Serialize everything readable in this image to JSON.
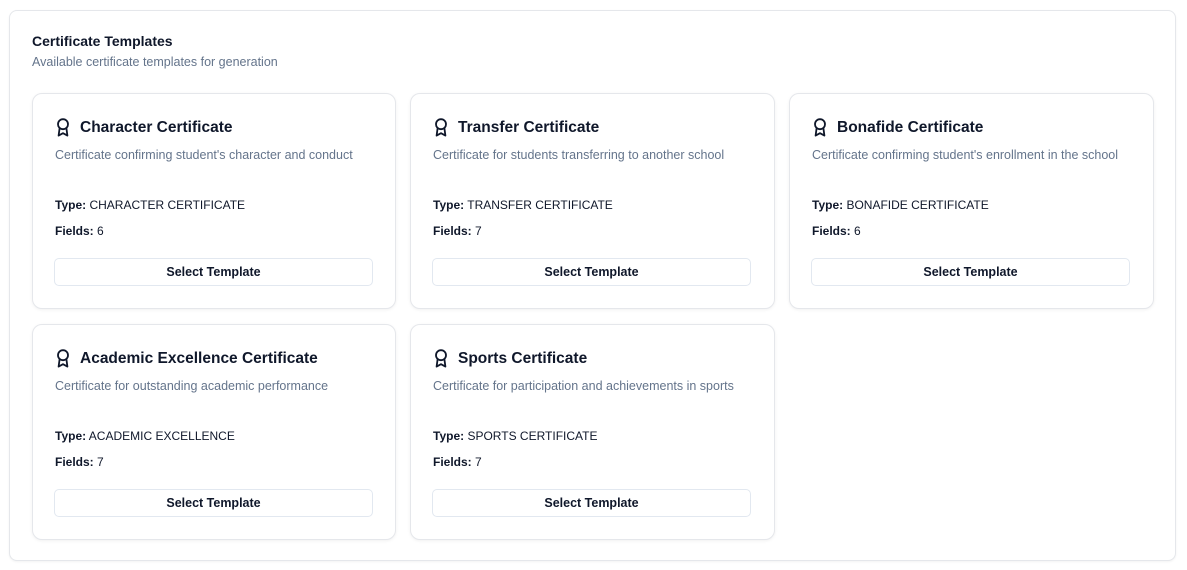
{
  "panel": {
    "title": "Certificate Templates",
    "subtitle": "Available certificate templates for generation"
  },
  "templates": [
    {
      "title": "Character Certificate",
      "description": "Certificate confirming student's character and conduct",
      "type_label": "Type:",
      "type_value": "CHARACTER CERTIFICATE",
      "fields_label": "Fields:",
      "fields_value": "6",
      "button_label": "Select Template",
      "icon": "award-icon"
    },
    {
      "title": "Transfer Certificate",
      "description": "Certificate for students transferring to another school",
      "type_label": "Type:",
      "type_value": "TRANSFER CERTIFICATE",
      "fields_label": "Fields:",
      "fields_value": "7",
      "button_label": "Select Template",
      "icon": "award-icon"
    },
    {
      "title": "Bonafide Certificate",
      "description": "Certificate confirming student's enrollment in the school",
      "type_label": "Type:",
      "type_value": "BONAFIDE CERTIFICATE",
      "fields_label": "Fields:",
      "fields_value": "6",
      "button_label": "Select Template",
      "icon": "award-icon"
    },
    {
      "title": "Academic Excellence Certificate",
      "description": "Certificate for outstanding academic performance",
      "type_label": "Type:",
      "type_value": "ACADEMIC EXCELLENCE",
      "fields_label": "Fields:",
      "fields_value": "7",
      "button_label": "Select Template",
      "icon": "award-icon"
    },
    {
      "title": "Sports Certificate",
      "description": "Certificate for participation and achievements in sports",
      "type_label": "Type:",
      "type_value": "SPORTS CERTIFICATE",
      "fields_label": "Fields:",
      "fields_value": "7",
      "button_label": "Select Template",
      "icon": "award-icon"
    }
  ],
  "colors": {
    "text_primary": "#0f172a",
    "text_muted": "#64748b",
    "border": "#e5e7eb"
  }
}
